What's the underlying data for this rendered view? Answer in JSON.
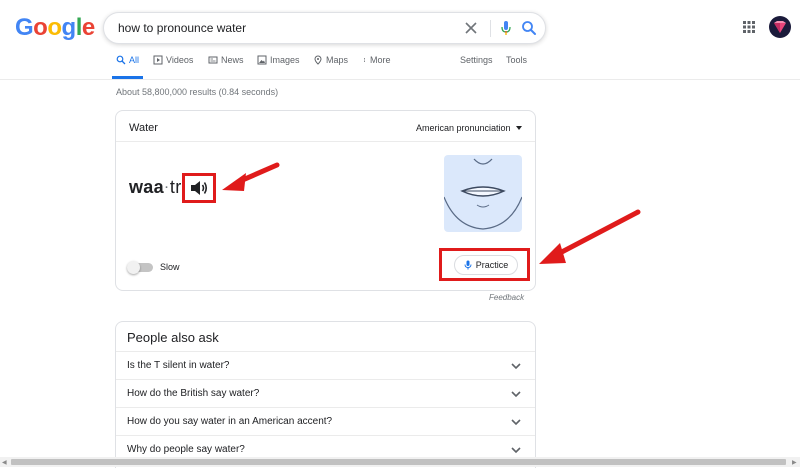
{
  "logo": {
    "letters": [
      "G",
      "o",
      "o",
      "g",
      "l",
      "e"
    ],
    "colors": [
      "#4285f4",
      "#ea4335",
      "#fbbc05",
      "#4285f4",
      "#34a853",
      "#ea4335"
    ]
  },
  "search": {
    "query": "how to pronounce water"
  },
  "tabs": [
    {
      "label": "All",
      "icon": "search-icon",
      "active": true
    },
    {
      "label": "Videos",
      "icon": "video-icon"
    },
    {
      "label": "News",
      "icon": "news-icon"
    },
    {
      "label": "Images",
      "icon": "image-icon"
    },
    {
      "label": "Maps",
      "icon": "map-pin-icon"
    },
    {
      "label": "More",
      "icon": "more-vertical-icon"
    }
  ],
  "tools": {
    "settings": "Settings",
    "tools": "Tools"
  },
  "results_stats": "About 58,800,000 results (0.84 seconds)",
  "pronunciation": {
    "word": "Water",
    "accent": "American pronunciation",
    "syllable_1": "waa",
    "syllable_2": "tr",
    "slow_label": "Slow",
    "practice_label": "Practice",
    "feedback": "Feedback"
  },
  "people_also_ask": {
    "title": "People also ask",
    "questions": [
      "Is the T silent in water?",
      "How do the British say water?",
      "How do you say water in an American accent?",
      "Why do people say water?"
    ]
  },
  "colors": {
    "accent": "#1a73e8",
    "highlight_red": "#e01b1b"
  }
}
